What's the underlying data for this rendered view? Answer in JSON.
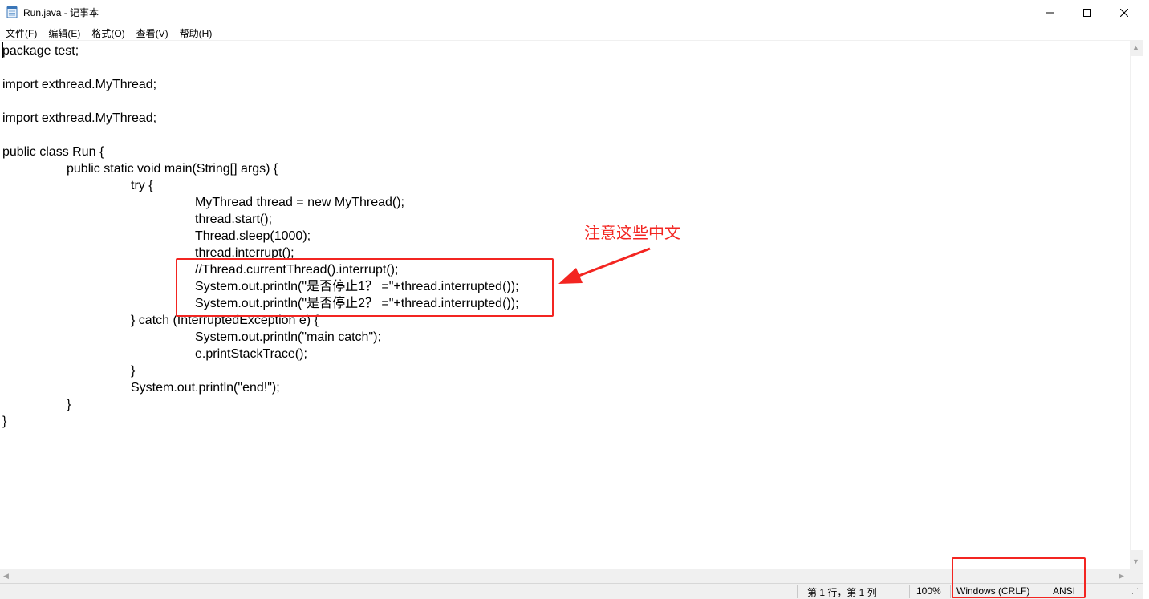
{
  "window": {
    "title": "Run.java - 记事本",
    "controls": {
      "minimize": "—",
      "maximize": "☐",
      "close": "✕"
    }
  },
  "menu": [
    {
      "label": "文件(F)"
    },
    {
      "label": "编辑(E)"
    },
    {
      "label": "格式(O)"
    },
    {
      "label": "查看(V)"
    },
    {
      "label": "帮助(H)"
    }
  ],
  "editor": {
    "lines": [
      "package test;",
      "",
      "import exthread.MyThread;",
      "",
      "import exthread.MyThread;",
      "",
      "public class Run {",
      "\t\tpublic static void main(String[] args) {",
      "\t\t\t\ttry {",
      "\t\t\t\t\t\tMyThread thread = new MyThread();",
      "\t\t\t\t\t\tthread.start();",
      "\t\t\t\t\t\tThread.sleep(1000);",
      "\t\t\t\t\t\tthread.interrupt();",
      "\t\t\t\t\t\t//Thread.currentThread().interrupt();",
      "\t\t\t\t\t\tSystem.out.println(\"是否停止1？ =\"+thread.interrupted());",
      "\t\t\t\t\t\tSystem.out.println(\"是否停止2？ =\"+thread.interrupted());",
      "\t\t\t\t} catch (InterruptedException e) {",
      "\t\t\t\t\t\tSystem.out.println(\"main catch\");",
      "\t\t\t\t\t\te.printStackTrace();",
      "\t\t\t\t}",
      "\t\t\t\tSystem.out.println(\"end!\");",
      "\t\t}",
      "}"
    ]
  },
  "status": {
    "position": "第 1 行，第 1 列",
    "zoom": "100%",
    "line_ending": "Windows (CRLF)",
    "encoding": "ANSI"
  },
  "annotation": {
    "note": "注意这些中文",
    "color": "#f32521"
  },
  "icons": [
    "notepad-icon",
    "minimize-icon",
    "maximize-icon",
    "close-icon",
    "scroll-up-icon",
    "scroll-down-icon",
    "scroll-left-icon",
    "scroll-right-icon"
  ]
}
